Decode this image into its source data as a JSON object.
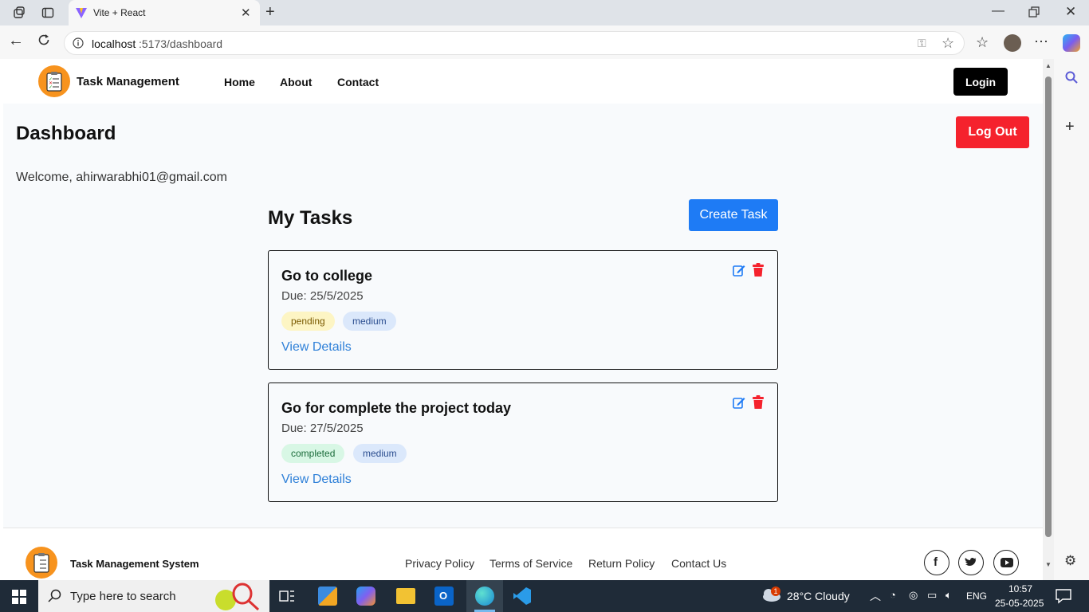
{
  "browser": {
    "tab_title": "Vite + React",
    "url_host": "localhost",
    "url_rest": ":5173/dashboard"
  },
  "nav": {
    "brand": "Task Management",
    "links": [
      "Home",
      "About",
      "Contact"
    ],
    "login": "Login"
  },
  "page": {
    "title": "Dashboard",
    "logout": "Log Out",
    "welcome": "Welcome, ahirwarabhi01@gmail.com",
    "tasks_heading": "My Tasks",
    "create_task": "Create Task"
  },
  "tasks": [
    {
      "title": "Go to college",
      "due": "Due: 25/5/2025",
      "status": "pending",
      "priority": "medium",
      "view": "View Details"
    },
    {
      "title": "Go for complete the project today",
      "due": "Due: 27/5/2025",
      "status": "completed",
      "priority": "medium",
      "view": "View Details"
    }
  ],
  "footer": {
    "brand": "Task Management System",
    "links": [
      "Privacy Policy",
      "Terms of Service",
      "Return Policy",
      "Contact Us"
    ],
    "social": [
      "facebook-icon",
      "twitter-icon",
      "youtube-icon"
    ]
  },
  "taskbar": {
    "search_placeholder": "Type here to search",
    "weather": "28°C  Cloudy",
    "lang": "ENG",
    "time": "10:57",
    "date": "25-05-2025",
    "weather_badge": "1"
  },
  "colors": {
    "accent": "#1e7bf5",
    "danger": "#f5222d",
    "pending_bg": "#fdf5c4",
    "completed_bg": "#d8f7e5",
    "medium_bg": "#dbe8fb"
  }
}
